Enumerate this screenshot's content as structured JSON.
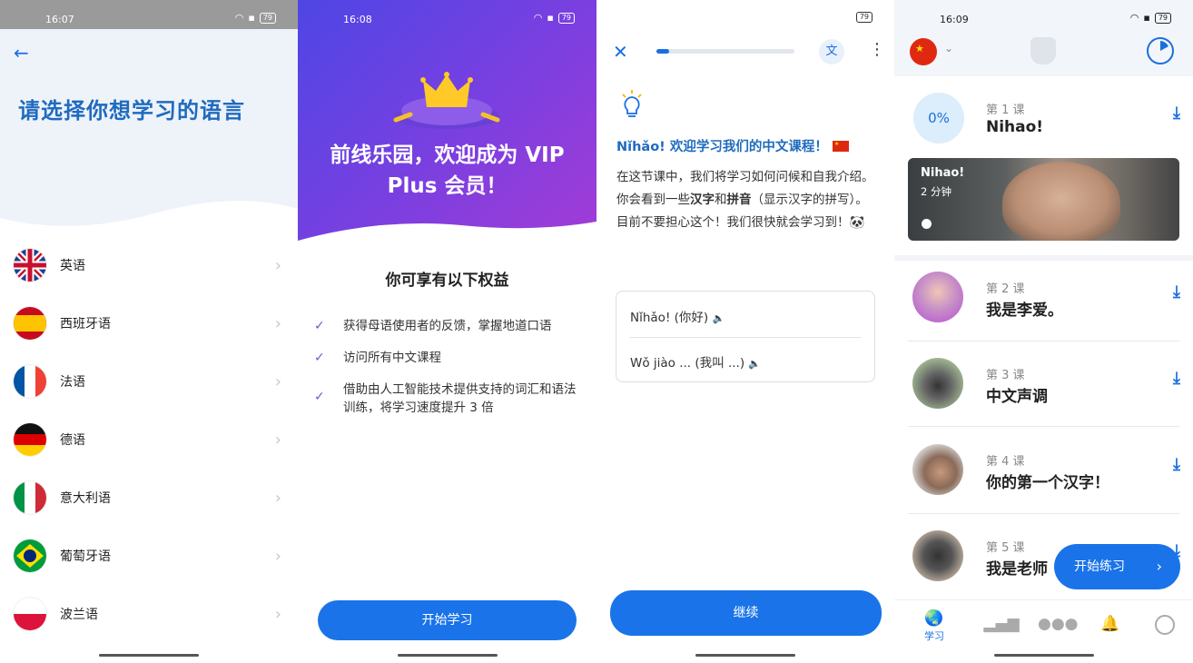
{
  "p1": {
    "status_time": "16:07",
    "battery": "79",
    "title": "请选择你想学习的语言",
    "languages": [
      {
        "label": "英语",
        "flag": "uk-flag"
      },
      {
        "label": "西班牙语",
        "flag": "spain-flag"
      },
      {
        "label": "法语",
        "flag": "france-flag"
      },
      {
        "label": "德语",
        "flag": "germany-flag"
      },
      {
        "label": "意大利语",
        "flag": "italy-flag"
      },
      {
        "label": "葡萄牙语",
        "flag": "brazil-flag"
      },
      {
        "label": "波兰语",
        "flag": "poland-flag"
      }
    ]
  },
  "p2": {
    "status_time": "16:08",
    "battery": "79",
    "hero_line1": "前线乐园，欢迎成为 VIP",
    "hero_line2": "Plus 会员！",
    "benefits_title": "你可享有以下权益",
    "benefits": [
      "获得母语使用者的反馈，掌握地道口语",
      "访问所有中文课程",
      "借助由人工智能技术提供支持的词汇和语法训练，将学习速度提升 3 倍"
    ],
    "start_button": "开始学习"
  },
  "p3": {
    "battery": "79",
    "progress": 0.09,
    "translate_glyph": "文",
    "lesson_heading": "Nǐhǎo! 欢迎学习我们的中文课程！",
    "body_1": "在这节课中，我们将学习如何问候和自我介绍。",
    "body_2a": "你会看到一些",
    "body_2b": "汉字",
    "body_2c": "和",
    "body_2d": "拼音",
    "body_2e": "（显示汉字的拼写）。目前不要担心这个！我们很快就会学习到！🐼",
    "phrases": [
      "Nǐhǎo! (你好)",
      "Wǒ jiào ... (我叫 ...)"
    ],
    "continue_button": "继续"
  },
  "p4": {
    "status_time": "16:09",
    "battery": "79",
    "lesson1": {
      "progress": "0%",
      "num": "第 1 课",
      "name": "Nihao!"
    },
    "video": {
      "title": "Nihao!",
      "duration": "2 分钟"
    },
    "lessons": [
      {
        "num": "第 2 课",
        "name": "我是李爱。"
      },
      {
        "num": "第 3 课",
        "name": "中文声调"
      },
      {
        "num": "第 4 课",
        "name": "你的第一个汉字！"
      },
      {
        "num": "第 5 课",
        "name": "我是老师"
      }
    ],
    "fab_label": "开始练习",
    "nav_learn": "学习"
  }
}
